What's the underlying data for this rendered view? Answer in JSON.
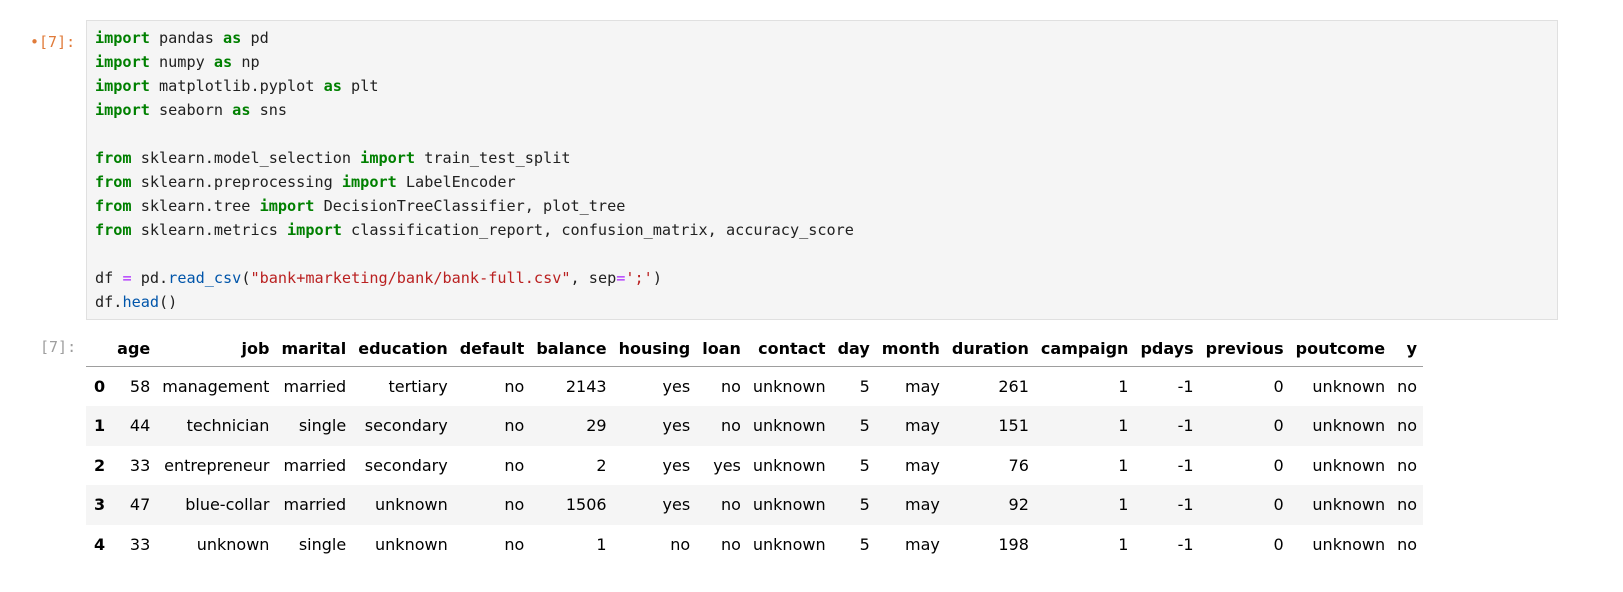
{
  "input_prompt": "•[7]:",
  "output_prompt": "[7]:",
  "code_lines": [
    [
      {
        "t": "import",
        "c": "kw"
      },
      {
        "t": " pandas "
      },
      {
        "t": "as",
        "c": "kw"
      },
      {
        "t": " pd"
      }
    ],
    [
      {
        "t": "import",
        "c": "kw"
      },
      {
        "t": " numpy "
      },
      {
        "t": "as",
        "c": "kw"
      },
      {
        "t": " np"
      }
    ],
    [
      {
        "t": "import",
        "c": "kw"
      },
      {
        "t": " matplotlib.pyplot "
      },
      {
        "t": "as",
        "c": "kw"
      },
      {
        "t": " plt"
      }
    ],
    [
      {
        "t": "import",
        "c": "kw"
      },
      {
        "t": " seaborn "
      },
      {
        "t": "as",
        "c": "kw"
      },
      {
        "t": " sns"
      }
    ],
    [],
    [
      {
        "t": "from",
        "c": "kw"
      },
      {
        "t": " sklearn.model_selection "
      },
      {
        "t": "import",
        "c": "kw"
      },
      {
        "t": " train_test_split"
      }
    ],
    [
      {
        "t": "from",
        "c": "kw"
      },
      {
        "t": " sklearn.preprocessing "
      },
      {
        "t": "import",
        "c": "kw"
      },
      {
        "t": " LabelEncoder"
      }
    ],
    [
      {
        "t": "from",
        "c": "kw"
      },
      {
        "t": " sklearn.tree "
      },
      {
        "t": "import",
        "c": "kw"
      },
      {
        "t": " DecisionTreeClassifier, plot_tree"
      }
    ],
    [
      {
        "t": "from",
        "c": "kw"
      },
      {
        "t": " sklearn.metrics "
      },
      {
        "t": "import",
        "c": "kw"
      },
      {
        "t": " classification_report, confusion_matrix, accuracy_score"
      }
    ],
    [],
    [
      {
        "t": "df "
      },
      {
        "t": "=",
        "c": "op"
      },
      {
        "t": " pd."
      },
      {
        "t": "read_csv",
        "c": "fn"
      },
      {
        "t": "("
      },
      {
        "t": "\"bank+marketing/bank/bank-full.csv\"",
        "c": "str"
      },
      {
        "t": ", sep"
      },
      {
        "t": "=",
        "c": "op"
      },
      {
        "t": "';'",
        "c": "str"
      },
      {
        "t": ")"
      }
    ],
    [
      {
        "t": "df."
      },
      {
        "t": "head",
        "c": "fn"
      },
      {
        "t": "()"
      }
    ]
  ],
  "table": {
    "columns": [
      "age",
      "job",
      "marital",
      "education",
      "default",
      "balance",
      "housing",
      "loan",
      "contact",
      "day",
      "month",
      "duration",
      "campaign",
      "pdays",
      "previous",
      "poutcome",
      "y"
    ],
    "rows": [
      {
        "index": "0",
        "cells": [
          "58",
          "management",
          "married",
          "tertiary",
          "no",
          "2143",
          "yes",
          "no",
          "unknown",
          "5",
          "may",
          "261",
          "1",
          "-1",
          "0",
          "unknown",
          "no"
        ]
      },
      {
        "index": "1",
        "cells": [
          "44",
          "technician",
          "single",
          "secondary",
          "no",
          "29",
          "yes",
          "no",
          "unknown",
          "5",
          "may",
          "151",
          "1",
          "-1",
          "0",
          "unknown",
          "no"
        ]
      },
      {
        "index": "2",
        "cells": [
          "33",
          "entrepreneur",
          "married",
          "secondary",
          "no",
          "2",
          "yes",
          "yes",
          "unknown",
          "5",
          "may",
          "76",
          "1",
          "-1",
          "0",
          "unknown",
          "no"
        ]
      },
      {
        "index": "3",
        "cells": [
          "47",
          "blue-collar",
          "married",
          "unknown",
          "no",
          "1506",
          "yes",
          "no",
          "unknown",
          "5",
          "may",
          "92",
          "1",
          "-1",
          "0",
          "unknown",
          "no"
        ]
      },
      {
        "index": "4",
        "cells": [
          "33",
          "unknown",
          "single",
          "unknown",
          "no",
          "1",
          "no",
          "no",
          "unknown",
          "5",
          "may",
          "198",
          "1",
          "-1",
          "0",
          "unknown",
          "no"
        ]
      }
    ]
  }
}
